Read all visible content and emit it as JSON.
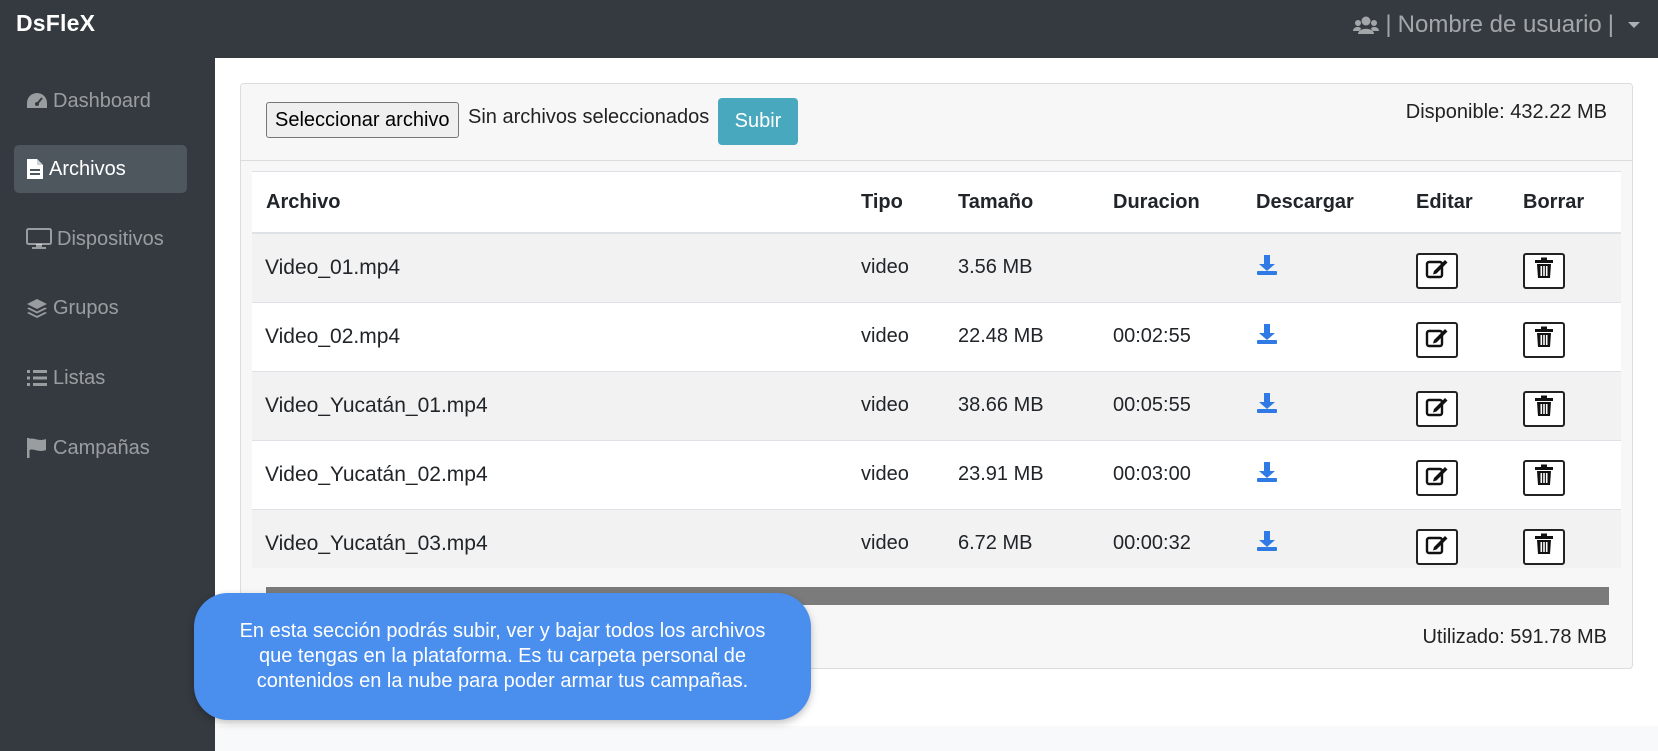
{
  "app": {
    "brand": "DsFleX"
  },
  "user_menu": {
    "icon": "users-icon",
    "separator": "|",
    "username": "Nombre de usuario"
  },
  "sidebar": {
    "items": [
      {
        "label": "Dashboard",
        "icon": "tachometer-icon",
        "active": false
      },
      {
        "label": "Archivos",
        "icon": "file-icon",
        "active": true
      },
      {
        "label": "Dispositivos",
        "icon": "desktop-icon",
        "active": false
      },
      {
        "label": "Grupos",
        "icon": "layers-icon",
        "active": false
      },
      {
        "label": "Listas",
        "icon": "list-icon",
        "active": false
      },
      {
        "label": "Campañas",
        "icon": "flag-icon",
        "active": false
      }
    ]
  },
  "upload": {
    "file_button": "Seleccionar archivo",
    "file_status": "Sin archivos seleccionados",
    "submit": "Subir",
    "available": "Disponible: 432.22 MB"
  },
  "table": {
    "headers": [
      "Archivo",
      "Tipo",
      "Tamaño",
      "Duracion",
      "Descargar",
      "Editar",
      "Borrar"
    ],
    "rows": [
      {
        "name": "Video_01.mp4",
        "type": "video",
        "size": "3.56 MB",
        "duration": ""
      },
      {
        "name": "Video_02.mp4",
        "type": "video",
        "size": "22.48 MB",
        "duration": "00:02:55"
      },
      {
        "name": "Video_Yucatán_01.mp4",
        "type": "video",
        "size": "38.66 MB",
        "duration": "00:05:55"
      },
      {
        "name": "Video_Yucatán_02.mp4",
        "type": "video",
        "size": "23.91 MB",
        "duration": "00:03:00"
      },
      {
        "name": "Video_Yucatán_03.mp4",
        "type": "video",
        "size": "6.72 MB",
        "duration": "00:00:32"
      }
    ]
  },
  "storage": {
    "used": "Utilizado: 591.78 MB",
    "used_fraction": 1.0
  },
  "tooltip": {
    "text": "En esta sección podrás subir, ver y bajar todos los archivos que tengas en la plataforma. Es tu carpeta personal de contenidos en la nube para poder armar tus campañas."
  },
  "colors": {
    "sidebar": "#343a40",
    "active_item": "#4f575e",
    "info_button": "#48a8bd",
    "download_icon": "#2f7ae5",
    "tooltip": "#4a8eee",
    "progress": "#7b7b7b"
  }
}
